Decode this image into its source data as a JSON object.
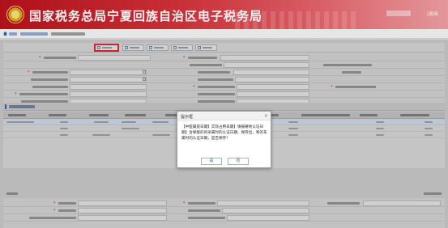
{
  "header": {
    "site_title": "国家税务总局宁夏回族自治区电子税务局",
    "logout_label": "|退出"
  },
  "dialog": {
    "title": "提示框",
    "close_glyph": "×",
    "message": "【中医属提日期】实际占用日期】填报耕地认证日期】合果能的的早属时的认证日期、保存出，和的车属时的认证日期，是否保存？",
    "confirm_label": "是",
    "cancel_label": "否"
  },
  "icons": {
    "home": "home-icon",
    "calendar": "calendar-icon",
    "toolbar": "toolbar-button-icon",
    "close": "close-icon"
  },
  "colors": {
    "banner_red": "#b8121b",
    "highlight_red": "#d8262d",
    "link_blue": "#2a63b0"
  }
}
